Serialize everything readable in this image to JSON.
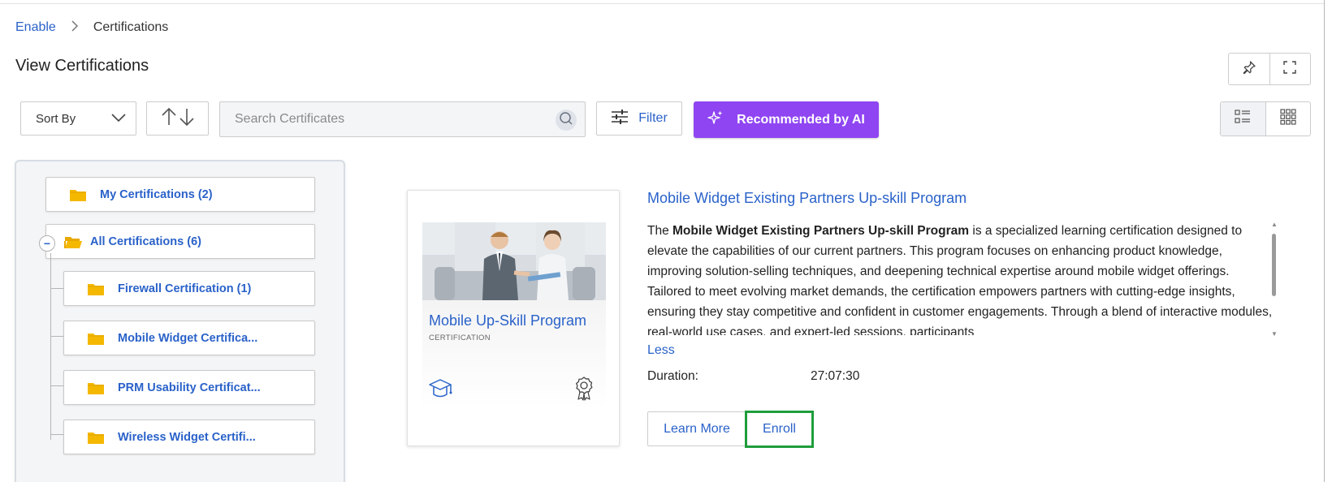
{
  "breadcrumb": {
    "parent": "Enable",
    "current": "Certifications"
  },
  "page": {
    "title": "View Certifications"
  },
  "toolbar": {
    "sort_label": "Sort By",
    "search_placeholder": "Search Certificates",
    "filter_label": "Filter",
    "ai_label": "Recommended by AI"
  },
  "tree": {
    "my": "My Certifications (2)",
    "all": "All Certifications (6)",
    "collapse_symbol": "−",
    "children": [
      "Firewall Certification (1)",
      "Mobile Widget Certifica...",
      "PRM Usability Certificat...",
      "Wireless Widget Certifi..."
    ]
  },
  "card": {
    "title": "Mobile Up-Skill Program",
    "type": "CERTIFICATION"
  },
  "detail": {
    "title": "Mobile Widget Existing Partners Up-skill Program",
    "desc_prefix": "The ",
    "desc_bold": "Mobile Widget Existing Partners Up-skill Program",
    "desc_rest": " is a specialized learning certification designed to elevate the capabilities of our current partners. This program focuses on enhancing product knowledge, improving solution-selling techniques, and deepening technical expertise around mobile widget offerings. Tailored to meet evolving market demands, the certification empowers partners with cutting-edge insights, ensuring they stay competitive and confident in customer engagements. Through a blend of interactive modules, real-world use cases, and expert-led sessions, participants",
    "less": "Less",
    "duration_label": "Duration:",
    "duration_value": "27:07:30",
    "learn_more": "Learn More",
    "enroll": "Enroll"
  },
  "colors": {
    "link": "#2a62c9",
    "ai_button": "#8f45f2",
    "folder": "#f5b800",
    "enroll_highlight": "#1f9d3b"
  },
  "icons": [
    "chevron-right-icon",
    "pin-icon",
    "fullscreen-icon",
    "chevron-down-icon",
    "sort-arrows-icon",
    "search-icon",
    "sliders-icon",
    "sparkle-icon",
    "list-view-icon",
    "grid-view-icon",
    "folder-icon",
    "folder-open-icon",
    "graduation-cap-icon",
    "award-badge-icon"
  ]
}
